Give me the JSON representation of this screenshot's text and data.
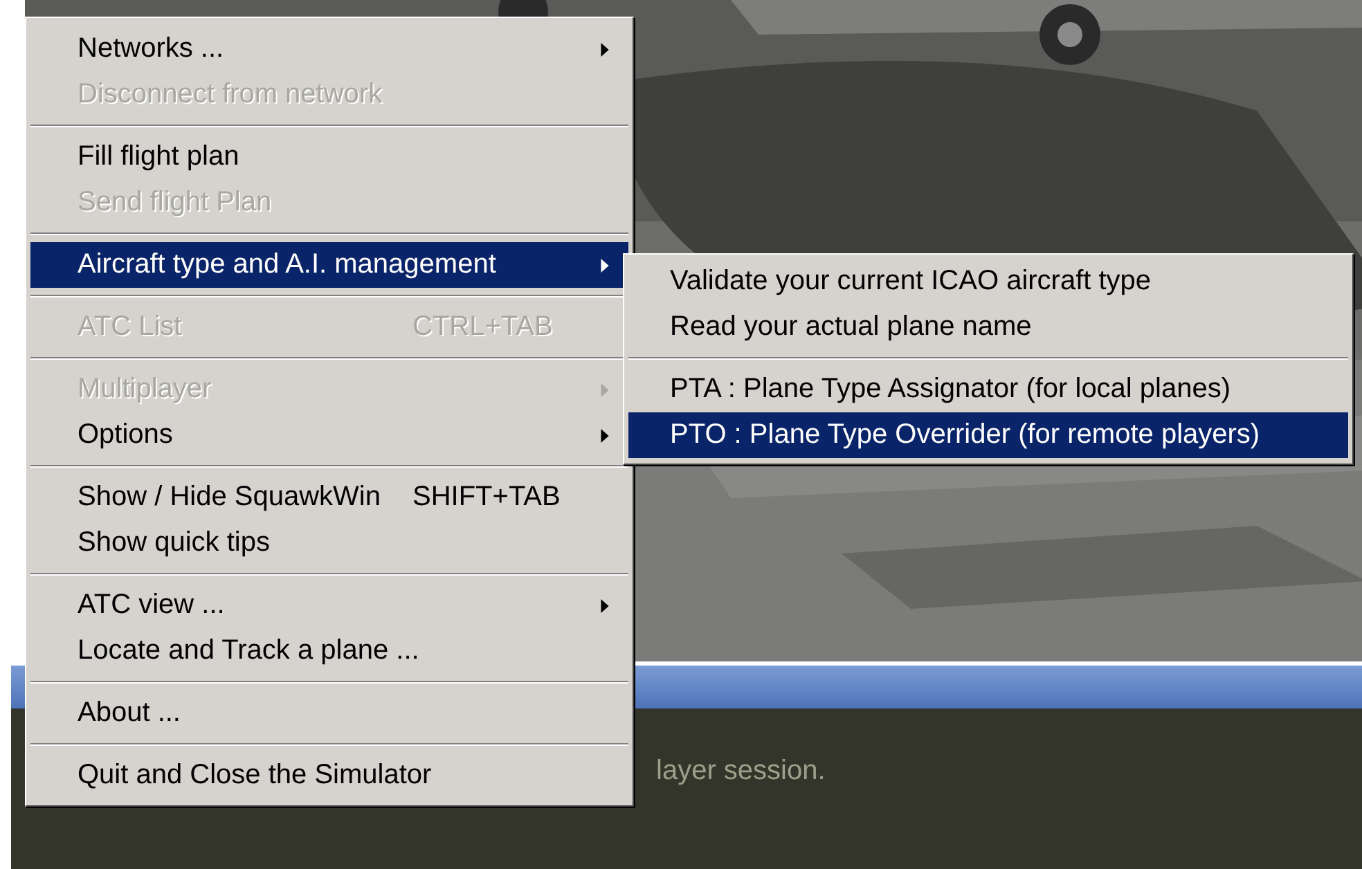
{
  "background": {
    "console_text": "layer session."
  },
  "menu": {
    "groups": [
      [
        {
          "label": "Networks ...",
          "disabled": false,
          "selected": false,
          "submenu": true
        },
        {
          "label": "Disconnect from network",
          "disabled": true,
          "selected": false,
          "submenu": false
        }
      ],
      [
        {
          "label": "Fill flight plan",
          "disabled": false,
          "selected": false,
          "submenu": false
        },
        {
          "label": "Send flight Plan",
          "disabled": true,
          "selected": false,
          "submenu": false
        }
      ],
      [
        {
          "label": "Aircraft type and A.I. management",
          "disabled": false,
          "selected": true,
          "submenu": true
        }
      ],
      [
        {
          "label": "ATC List",
          "shortcut": "CTRL+TAB",
          "disabled": true,
          "selected": false,
          "submenu": false
        }
      ],
      [
        {
          "label": "Multiplayer",
          "disabled": true,
          "selected": false,
          "submenu": true
        },
        {
          "label": "Options",
          "disabled": false,
          "selected": false,
          "submenu": true
        }
      ],
      [
        {
          "label": "Show / Hide SquawkWin",
          "shortcut": "SHIFT+TAB",
          "disabled": false,
          "selected": false,
          "submenu": false
        },
        {
          "label": "Show quick tips",
          "disabled": false,
          "selected": false,
          "submenu": false
        }
      ],
      [
        {
          "label": "ATC view ...",
          "disabled": false,
          "selected": false,
          "submenu": true
        },
        {
          "label": "Locate and Track a plane ...",
          "disabled": false,
          "selected": false,
          "submenu": false
        }
      ],
      [
        {
          "label": "About ...",
          "disabled": false,
          "selected": false,
          "submenu": false
        }
      ],
      [
        {
          "label": "Quit and Close the Simulator",
          "disabled": false,
          "selected": false,
          "submenu": false
        }
      ]
    ]
  },
  "submenu": {
    "groups": [
      [
        {
          "label": "Validate your current ICAO aircraft type",
          "selected": false
        },
        {
          "label": "Read your actual plane name",
          "selected": false
        }
      ],
      [
        {
          "label": "PTA : Plane Type Assignator (for local planes)",
          "selected": false
        },
        {
          "label": "PTO : Plane Type Overrider (for remote players)",
          "selected": true
        }
      ]
    ]
  }
}
